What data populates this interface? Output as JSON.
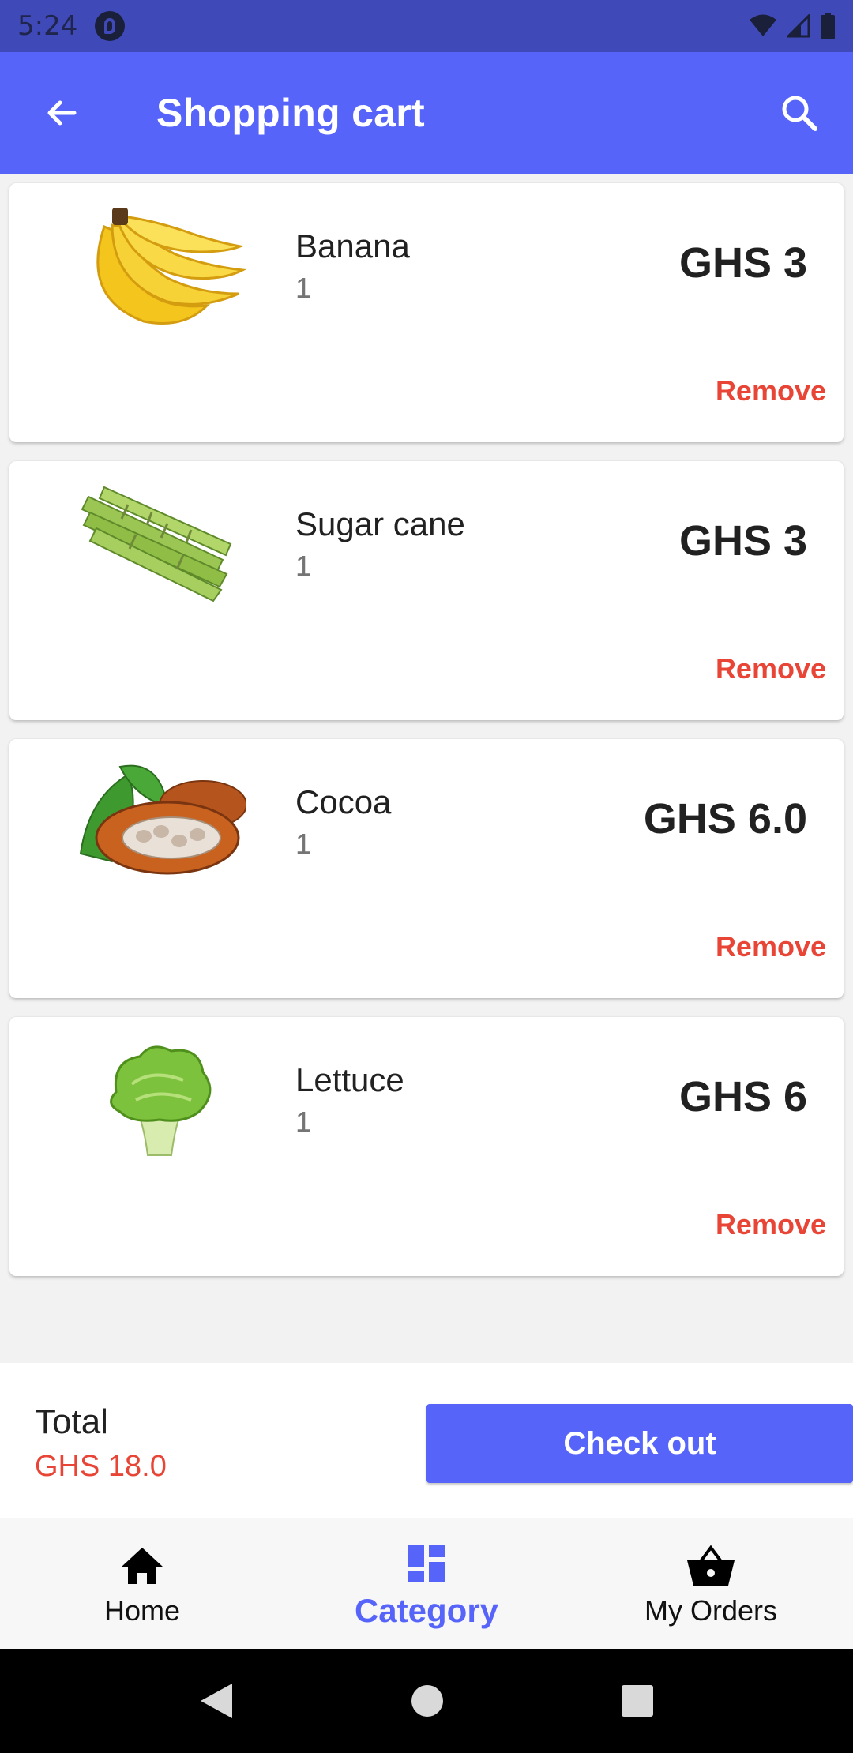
{
  "status_bar": {
    "time": "5:24"
  },
  "app_bar": {
    "title": "Shopping cart"
  },
  "cart_items": [
    {
      "name": "Banana",
      "quantity": "1",
      "price": "GHS 3",
      "remove_label": "Remove",
      "image_icon": "banana-image"
    },
    {
      "name": "Sugar cane",
      "quantity": "1",
      "price": "GHS 3",
      "remove_label": "Remove",
      "image_icon": "sugar-cane-image"
    },
    {
      "name": "Cocoa",
      "quantity": "1",
      "price": "GHS 6.0",
      "remove_label": "Remove",
      "image_icon": "cocoa-image"
    },
    {
      "name": "Lettuce",
      "quantity": "1",
      "price": "GHS 6",
      "remove_label": "Remove",
      "image_icon": "lettuce-image"
    }
  ],
  "summary": {
    "total_label": "Total",
    "total_value": "GHS 18.0",
    "checkout_label": "Check out"
  },
  "bottom_nav": [
    {
      "label": "Home",
      "icon": "home-icon",
      "active": false
    },
    {
      "label": "Category",
      "icon": "dashboard-icon",
      "active": true
    },
    {
      "label": "My Orders",
      "icon": "basket-icon",
      "active": false
    }
  ],
  "colors": {
    "primary": "#5664fa",
    "status_bar": "#3f4ab8",
    "accent_red": "#e84536"
  }
}
